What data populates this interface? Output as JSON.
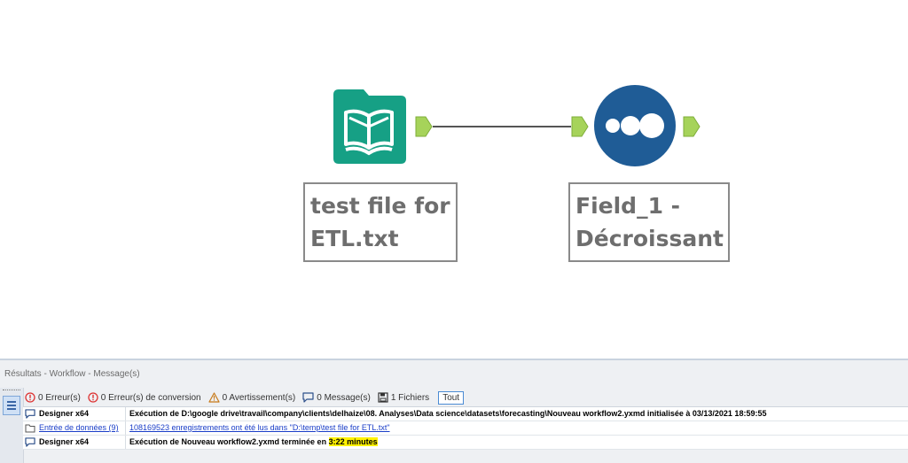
{
  "canvas": {
    "annotation_input": "test file for\nETL.txt",
    "annotation_sort": "Field_1 -\nDécroissant"
  },
  "results": {
    "title": "Résultats - Workflow - Message(s)",
    "filters": {
      "errors": "0 Erreur(s)",
      "conversion_errors": "0 Erreur(s) de conversion",
      "warnings": "0 Avertissement(s)",
      "messages": "0 Message(s)",
      "files": "1 Fichiers",
      "all": "Tout"
    },
    "rows": [
      {
        "source": "Designer x64",
        "text": "Exécution de D:\\google drive\\travail\\company\\clients\\delhaize\\08. Analyses\\Data science\\datasets\\forecasting\\Nouveau workflow2.yxmd initialisée à 03/13/2021 18:59:55"
      },
      {
        "source": "Entrée de données (9)",
        "text": "108169523 enregistrements ont été lus dans \"D:\\temp\\test file for ETL.txt\""
      },
      {
        "source": "Designer x64",
        "text": "Exécution de Nouveau workflow2.yxmd terminée en ",
        "highlight": "3:22 minutes"
      }
    ]
  },
  "colors": {
    "input_tool": "#16a085",
    "sort_tool": "#1f5c96",
    "connector": "#a6d35a",
    "highlight": "#fff200"
  },
  "icons": {
    "input_tool": "book-icon",
    "sort_tool": "three-dots-icon",
    "error": "error-circle-icon",
    "warning": "warning-triangle-icon",
    "message": "message-bubble-icon",
    "file": "save-file-icon"
  }
}
